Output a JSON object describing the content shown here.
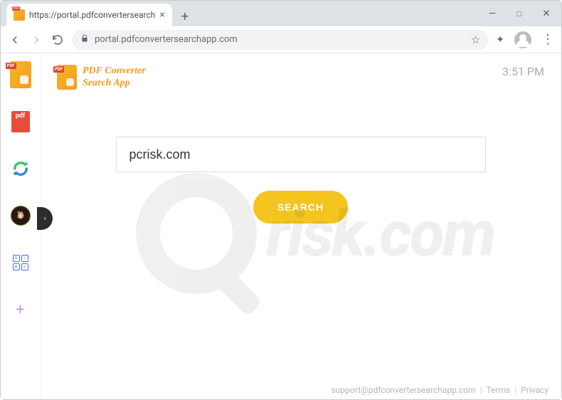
{
  "browser": {
    "tab_title": "https://portal.pdfconvertersearch",
    "url_display": "portal.pdfconvertersearchapp.com",
    "new_tab_glyph": "+",
    "tab_close_glyph": "×",
    "minimize_glyph": "—",
    "maximize_glyph": "□",
    "close_glyph": "✕",
    "star_glyph": "☆",
    "ext_glyph": "✦",
    "menu_glyph": "⋮"
  },
  "sidebar": {
    "items": [
      {
        "name": "app-icon"
      },
      {
        "name": "pdf-tool"
      },
      {
        "name": "refresh-tool"
      },
      {
        "name": "badge-tool",
        "label": "B"
      },
      {
        "name": "calculator-tool"
      },
      {
        "name": "add-tool",
        "glyph": "+"
      }
    ],
    "expand_glyph": "‹"
  },
  "brand": {
    "line1": "PDF Converter",
    "line2": "Search App"
  },
  "clock": "3:51 PM",
  "search": {
    "value": "pcrisk.com",
    "button_label": "SEARCH"
  },
  "footer": {
    "email": "support@pdfconvertersearchapp.com",
    "terms": "Terms",
    "privacy": "Privacy",
    "sep": "|"
  },
  "watermark_text": "risk.com"
}
